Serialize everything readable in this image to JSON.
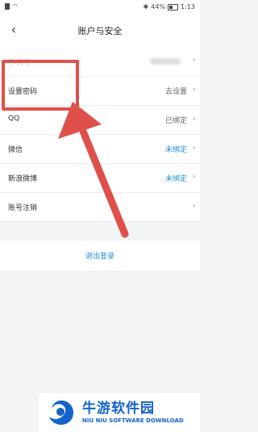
{
  "status_bar": {
    "battery": "44%",
    "time": "1:13"
  },
  "header": {
    "title": "账户与安全"
  },
  "settings": [
    {
      "label": "手机号",
      "value": "",
      "value_style": "masked"
    },
    {
      "label": "设置密码",
      "value": "去设置",
      "value_style": "gray"
    },
    {
      "label": "QQ",
      "value": "已绑定",
      "value_style": "gray"
    },
    {
      "label": "微信",
      "value": "未绑定",
      "value_style": "blue"
    },
    {
      "label": "新浪微博",
      "value": "未绑定",
      "value_style": "blue"
    },
    {
      "label": "账号注销",
      "value": "",
      "value_style": "none"
    }
  ],
  "logout_label": "退出登录",
  "watermark": {
    "title": "牛游软件园",
    "subtitle": "NIU NIU SOFTWARE DOWNLOAD"
  },
  "colors": {
    "accent_blue": "#1f8fd6",
    "annotation_red": "#e0504a",
    "watermark_blue": "#1463c8"
  },
  "icons": [
    "sim-icon",
    "wifi-icon",
    "bluetooth-icon",
    "battery-icon",
    "back-icon",
    "chevron-right-icon"
  ]
}
